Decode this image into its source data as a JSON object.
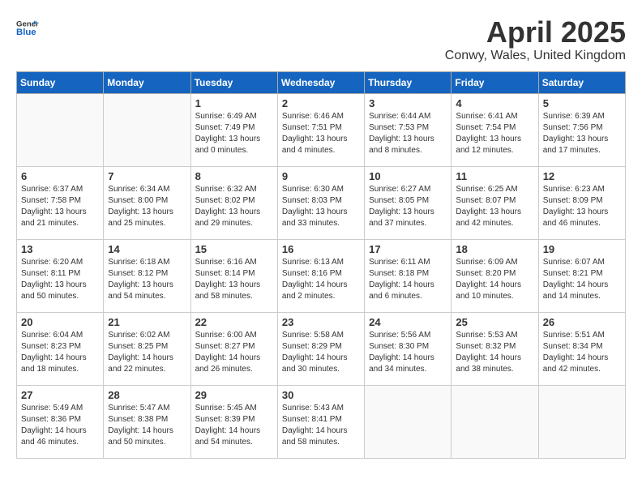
{
  "header": {
    "logo_general": "General",
    "logo_blue": "Blue",
    "title": "April 2025",
    "subtitle": "Conwy, Wales, United Kingdom"
  },
  "weekdays": [
    "Sunday",
    "Monday",
    "Tuesday",
    "Wednesday",
    "Thursday",
    "Friday",
    "Saturday"
  ],
  "weeks": [
    [
      {
        "day": "",
        "info": ""
      },
      {
        "day": "",
        "info": ""
      },
      {
        "day": "1",
        "info": "Sunrise: 6:49 AM\nSunset: 7:49 PM\nDaylight: 13 hours\nand 0 minutes."
      },
      {
        "day": "2",
        "info": "Sunrise: 6:46 AM\nSunset: 7:51 PM\nDaylight: 13 hours\nand 4 minutes."
      },
      {
        "day": "3",
        "info": "Sunrise: 6:44 AM\nSunset: 7:53 PM\nDaylight: 13 hours\nand 8 minutes."
      },
      {
        "day": "4",
        "info": "Sunrise: 6:41 AM\nSunset: 7:54 PM\nDaylight: 13 hours\nand 12 minutes."
      },
      {
        "day": "5",
        "info": "Sunrise: 6:39 AM\nSunset: 7:56 PM\nDaylight: 13 hours\nand 17 minutes."
      }
    ],
    [
      {
        "day": "6",
        "info": "Sunrise: 6:37 AM\nSunset: 7:58 PM\nDaylight: 13 hours\nand 21 minutes."
      },
      {
        "day": "7",
        "info": "Sunrise: 6:34 AM\nSunset: 8:00 PM\nDaylight: 13 hours\nand 25 minutes."
      },
      {
        "day": "8",
        "info": "Sunrise: 6:32 AM\nSunset: 8:02 PM\nDaylight: 13 hours\nand 29 minutes."
      },
      {
        "day": "9",
        "info": "Sunrise: 6:30 AM\nSunset: 8:03 PM\nDaylight: 13 hours\nand 33 minutes."
      },
      {
        "day": "10",
        "info": "Sunrise: 6:27 AM\nSunset: 8:05 PM\nDaylight: 13 hours\nand 37 minutes."
      },
      {
        "day": "11",
        "info": "Sunrise: 6:25 AM\nSunset: 8:07 PM\nDaylight: 13 hours\nand 42 minutes."
      },
      {
        "day": "12",
        "info": "Sunrise: 6:23 AM\nSunset: 8:09 PM\nDaylight: 13 hours\nand 46 minutes."
      }
    ],
    [
      {
        "day": "13",
        "info": "Sunrise: 6:20 AM\nSunset: 8:11 PM\nDaylight: 13 hours\nand 50 minutes."
      },
      {
        "day": "14",
        "info": "Sunrise: 6:18 AM\nSunset: 8:12 PM\nDaylight: 13 hours\nand 54 minutes."
      },
      {
        "day": "15",
        "info": "Sunrise: 6:16 AM\nSunset: 8:14 PM\nDaylight: 13 hours\nand 58 minutes."
      },
      {
        "day": "16",
        "info": "Sunrise: 6:13 AM\nSunset: 8:16 PM\nDaylight: 14 hours\nand 2 minutes."
      },
      {
        "day": "17",
        "info": "Sunrise: 6:11 AM\nSunset: 8:18 PM\nDaylight: 14 hours\nand 6 minutes."
      },
      {
        "day": "18",
        "info": "Sunrise: 6:09 AM\nSunset: 8:20 PM\nDaylight: 14 hours\nand 10 minutes."
      },
      {
        "day": "19",
        "info": "Sunrise: 6:07 AM\nSunset: 8:21 PM\nDaylight: 14 hours\nand 14 minutes."
      }
    ],
    [
      {
        "day": "20",
        "info": "Sunrise: 6:04 AM\nSunset: 8:23 PM\nDaylight: 14 hours\nand 18 minutes."
      },
      {
        "day": "21",
        "info": "Sunrise: 6:02 AM\nSunset: 8:25 PM\nDaylight: 14 hours\nand 22 minutes."
      },
      {
        "day": "22",
        "info": "Sunrise: 6:00 AM\nSunset: 8:27 PM\nDaylight: 14 hours\nand 26 minutes."
      },
      {
        "day": "23",
        "info": "Sunrise: 5:58 AM\nSunset: 8:29 PM\nDaylight: 14 hours\nand 30 minutes."
      },
      {
        "day": "24",
        "info": "Sunrise: 5:56 AM\nSunset: 8:30 PM\nDaylight: 14 hours\nand 34 minutes."
      },
      {
        "day": "25",
        "info": "Sunrise: 5:53 AM\nSunset: 8:32 PM\nDaylight: 14 hours\nand 38 minutes."
      },
      {
        "day": "26",
        "info": "Sunrise: 5:51 AM\nSunset: 8:34 PM\nDaylight: 14 hours\nand 42 minutes."
      }
    ],
    [
      {
        "day": "27",
        "info": "Sunrise: 5:49 AM\nSunset: 8:36 PM\nDaylight: 14 hours\nand 46 minutes."
      },
      {
        "day": "28",
        "info": "Sunrise: 5:47 AM\nSunset: 8:38 PM\nDaylight: 14 hours\nand 50 minutes."
      },
      {
        "day": "29",
        "info": "Sunrise: 5:45 AM\nSunset: 8:39 PM\nDaylight: 14 hours\nand 54 minutes."
      },
      {
        "day": "30",
        "info": "Sunrise: 5:43 AM\nSunset: 8:41 PM\nDaylight: 14 hours\nand 58 minutes."
      },
      {
        "day": "",
        "info": ""
      },
      {
        "day": "",
        "info": ""
      },
      {
        "day": "",
        "info": ""
      }
    ]
  ]
}
